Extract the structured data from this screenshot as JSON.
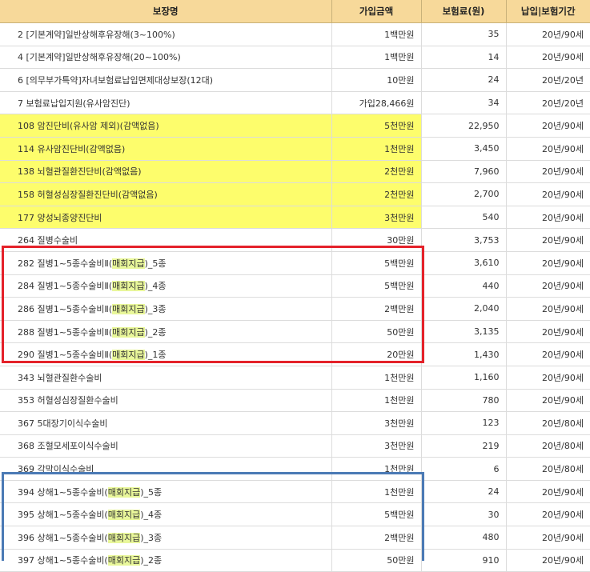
{
  "header": {
    "col_name": "보장명",
    "col_amount": "가입금액",
    "col_premium": "보험료(원)",
    "col_period": "납입|보험기간"
  },
  "colors": {
    "header_bg": "#f7d99a",
    "highlight": "#fdfd6c",
    "red_box": "#e4222a",
    "blue_box": "#4b7ab5",
    "pay_tag": "#e9f79a"
  },
  "rows": [
    {
      "no": "2",
      "name": "[기본계약]일반상해후유장해(3~100%)",
      "tag": "",
      "suffix": "",
      "amount": "1백만원",
      "premium": "35",
      "period": "20년/90세",
      "hl": false
    },
    {
      "no": "4",
      "name": "[기본계약]일반상해후유장해(20~100%)",
      "tag": "",
      "suffix": "",
      "amount": "1백만원",
      "premium": "14",
      "period": "20년/90세",
      "hl": false
    },
    {
      "no": "6",
      "name": "[의무부가특약]자녀보험료납입면제대상보장(12대)",
      "tag": "",
      "suffix": "",
      "amount": "10만원",
      "premium": "24",
      "period": "20년/20년",
      "hl": false
    },
    {
      "no": "7",
      "name": "보험료납입지원(유사암진단)",
      "tag": "",
      "suffix": "",
      "amount": "가입28,466원",
      "premium": "34",
      "period": "20년/20년",
      "hl": false
    },
    {
      "no": "108",
      "name": "암진단비(유사암 제외)(감액없음)",
      "tag": "",
      "suffix": "",
      "amount": "5천만원",
      "premium": "22,950",
      "period": "20년/90세",
      "hl": true
    },
    {
      "no": "114",
      "name": "유사암진단비(감액없음)",
      "tag": "",
      "suffix": "",
      "amount": "1천만원",
      "premium": "3,450",
      "period": "20년/90세",
      "hl": true
    },
    {
      "no": "138",
      "name": "뇌혈관질환진단비(감액없음)",
      "tag": "",
      "suffix": "",
      "amount": "2천만원",
      "premium": "7,960",
      "period": "20년/90세",
      "hl": true
    },
    {
      "no": "158",
      "name": "허혈성심장질환진단비(감액없음)",
      "tag": "",
      "suffix": "",
      "amount": "2천만원",
      "premium": "2,700",
      "period": "20년/90세",
      "hl": true
    },
    {
      "no": "177",
      "name": "양성뇌종양진단비",
      "tag": "",
      "suffix": "",
      "amount": "3천만원",
      "premium": "540",
      "period": "20년/90세",
      "hl": true
    },
    {
      "no": "264",
      "name": "질병수술비",
      "tag": "",
      "suffix": "",
      "amount": "30만원",
      "premium": "3,753",
      "period": "20년/90세",
      "hl": false
    },
    {
      "no": "282",
      "name": "질병1~5종수술비Ⅱ(",
      "tag": "매회지급",
      "suffix": ")_5종",
      "amount": "5백만원",
      "premium": "3,610",
      "period": "20년/90세",
      "hl": false
    },
    {
      "no": "284",
      "name": "질병1~5종수술비Ⅱ(",
      "tag": "매회지급",
      "suffix": ")_4종",
      "amount": "5백만원",
      "premium": "440",
      "period": "20년/90세",
      "hl": false
    },
    {
      "no": "286",
      "name": "질병1~5종수술비Ⅱ(",
      "tag": "매회지급",
      "suffix": ")_3종",
      "amount": "2백만원",
      "premium": "2,040",
      "period": "20년/90세",
      "hl": false
    },
    {
      "no": "288",
      "name": "질병1~5종수술비Ⅱ(",
      "tag": "매회지급",
      "suffix": ")_2종",
      "amount": "50만원",
      "premium": "3,135",
      "period": "20년/90세",
      "hl": false
    },
    {
      "no": "290",
      "name": "질병1~5종수술비Ⅱ(",
      "tag": "매회지급",
      "suffix": ")_1종",
      "amount": "20만원",
      "premium": "1,430",
      "period": "20년/90세",
      "hl": false
    },
    {
      "no": "343",
      "name": "뇌혈관질환수술비",
      "tag": "",
      "suffix": "",
      "amount": "1천만원",
      "premium": "1,160",
      "period": "20년/90세",
      "hl": false
    },
    {
      "no": "353",
      "name": "허혈성심장질환수술비",
      "tag": "",
      "suffix": "",
      "amount": "1천만원",
      "premium": "780",
      "period": "20년/90세",
      "hl": false
    },
    {
      "no": "367",
      "name": "5대장기이식수술비",
      "tag": "",
      "suffix": "",
      "amount": "3천만원",
      "premium": "123",
      "period": "20년/80세",
      "hl": false
    },
    {
      "no": "368",
      "name": "조혈모세포이식수술비",
      "tag": "",
      "suffix": "",
      "amount": "3천만원",
      "premium": "219",
      "period": "20년/80세",
      "hl": false
    },
    {
      "no": "369",
      "name": "각막이식수술비",
      "tag": "",
      "suffix": "",
      "amount": "1천만원",
      "premium": "6",
      "period": "20년/80세",
      "hl": false
    },
    {
      "no": "394",
      "name": "상해1~5종수술비(",
      "tag": "매회지급",
      "suffix": ")_5종",
      "amount": "1천만원",
      "premium": "24",
      "period": "20년/90세",
      "hl": false
    },
    {
      "no": "395",
      "name": "상해1~5종수술비(",
      "tag": "매회지급",
      "suffix": ")_4종",
      "amount": "5백만원",
      "premium": "30",
      "period": "20년/90세",
      "hl": false
    },
    {
      "no": "396",
      "name": "상해1~5종수술비(",
      "tag": "매회지급",
      "suffix": ")_3종",
      "amount": "2백만원",
      "premium": "480",
      "period": "20년/90세",
      "hl": false
    },
    {
      "no": "397",
      "name": "상해1~5종수술비(",
      "tag": "매회지급",
      "suffix": ")_2종",
      "amount": "50만원",
      "premium": "910",
      "period": "20년/90세",
      "hl": false
    }
  ]
}
